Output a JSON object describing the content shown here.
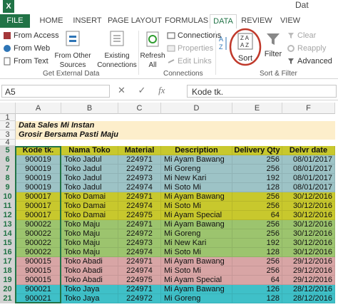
{
  "window": {
    "title": "Dat"
  },
  "tabs": [
    "FILE",
    "HOME",
    "INSERT",
    "PAGE LAYOUT",
    "FORMULAS",
    "DATA",
    "REVIEW",
    "VIEW"
  ],
  "ribbon": {
    "get_external": [
      "From Access",
      "From Web",
      "From Text"
    ],
    "from_other_sources": "From Other Sources",
    "existing_connections": "Existing Connections",
    "refresh_all": "Refresh All",
    "connections": "Connections",
    "properties": "Properties",
    "edit_links": "Edit Links",
    "sort": "Sort",
    "filter": "Filter",
    "clear": "Clear",
    "reapply": "Reapply",
    "advanced": "Advanced",
    "groups": [
      "Get External Data",
      "Connections",
      "Sort & Filter"
    ]
  },
  "formula_bar": {
    "name_box": "A5",
    "fx": "fx",
    "content": "Kode tk."
  },
  "columns": [
    "A",
    "B",
    "C",
    "D",
    "E",
    "F"
  ],
  "title_rows": {
    "r2": "Data Sales Mi Instan",
    "r3": "Grosir Bersama Pasti Maju"
  },
  "header": [
    "Kode tk.",
    "Nama Toko",
    "Material",
    "Description",
    "Delivery Qty",
    "Delvr date"
  ],
  "rows": [
    {
      "n": "5",
      "header": true
    },
    {
      "n": "6",
      "v": [
        "900019",
        "Toko Jadul",
        "224971",
        "Mi  Ayam Bawang",
        "256",
        "08/01/2017"
      ],
      "color": "#9dc3c6"
    },
    {
      "n": "7",
      "v": [
        "900019",
        "Toko Jadul",
        "224972",
        "Mi  Goreng",
        "256",
        "08/01/2017"
      ],
      "color": "#9dc3c6"
    },
    {
      "n": "8",
      "v": [
        "900019",
        "Toko Jadul",
        "224973",
        "Mi  New Kari",
        "192",
        "08/01/2017"
      ],
      "color": "#9dc3c6"
    },
    {
      "n": "9",
      "v": [
        "900019",
        "Toko Jadul",
        "224974",
        "Mi  Soto Mi",
        "128",
        "08/01/2017"
      ],
      "color": "#9dc3c6"
    },
    {
      "n": "10",
      "v": [
        "900017",
        "Toko Damai",
        "224971",
        "Mi  Ayam Bawang",
        "256",
        "30/12/2016"
      ],
      "color": "#c8c82d"
    },
    {
      "n": "11",
      "v": [
        "900017",
        "Toko Damai",
        "224974",
        "Mi  Soto Mi",
        "256",
        "30/12/2016"
      ],
      "color": "#c8c82d"
    },
    {
      "n": "12",
      "v": [
        "900017",
        "Toko Damai",
        "224975",
        "Mi Ayam Special",
        "64",
        "30/12/2016"
      ],
      "color": "#c8c82d"
    },
    {
      "n": "13",
      "v": [
        "900022",
        "Toko Maju",
        "224971",
        "Mi  Ayam Bawang",
        "256",
        "30/12/2016"
      ],
      "color": "#9cc46e"
    },
    {
      "n": "14",
      "v": [
        "900022",
        "Toko Maju",
        "224972",
        "Mi  Goreng",
        "256",
        "30/12/2016"
      ],
      "color": "#9cc46e"
    },
    {
      "n": "15",
      "v": [
        "900022",
        "Toko Maju",
        "224973",
        "Mi  New Kari",
        "192",
        "30/12/2016"
      ],
      "color": "#9cc46e"
    },
    {
      "n": "16",
      "v": [
        "900022",
        "Toko Maju",
        "224974",
        "Mi  Soto Mi",
        "128",
        "30/12/2016"
      ],
      "color": "#9cc46e"
    },
    {
      "n": "17",
      "v": [
        "900015",
        "Toko Abadi",
        "224971",
        "Mi  Ayam Bawang",
        "256",
        "29/12/2016"
      ],
      "color": "#d8a5a5"
    },
    {
      "n": "18",
      "v": [
        "900015",
        "Toko Abadi",
        "224974",
        "Mi  Soto Mi",
        "256",
        "29/12/2016"
      ],
      "color": "#d8a5a5"
    },
    {
      "n": "19",
      "v": [
        "900015",
        "Toko Abadi",
        "224975",
        "Mi Ayam Special",
        "64",
        "29/12/2016"
      ],
      "color": "#d8a5a5"
    },
    {
      "n": "20",
      "v": [
        "900021",
        "Toko Jaya",
        "224971",
        "Mi  Ayam Bawang",
        "126",
        "28/12/2016"
      ],
      "color": "#3fc0c8"
    },
    {
      "n": "21",
      "v": [
        "900021",
        "Toko Jaya",
        "224972",
        "Mi  Goreng",
        "128",
        "28/12/2016"
      ],
      "color": "#3fc0c8"
    }
  ],
  "colors": {
    "excel_green": "#217346",
    "title_fill": "#fdeecb",
    "header_fill": "#c8c82d",
    "sort_circle": "#c0392b"
  }
}
